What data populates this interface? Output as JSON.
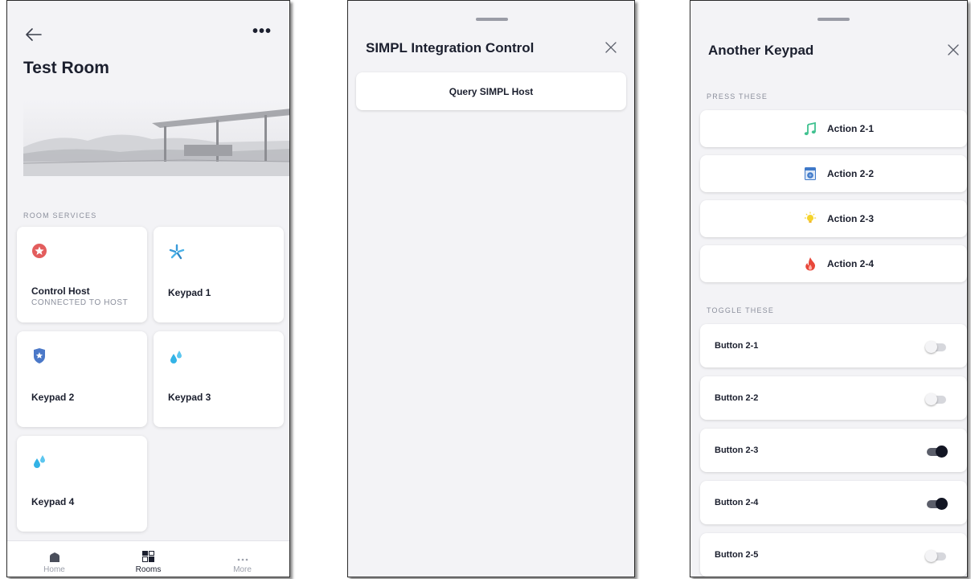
{
  "room": {
    "title": "Test Room",
    "section_label": "ROOM SERVICES",
    "tiles": [
      {
        "name": "Control Host",
        "subtitle": "CONNECTED TO HOST",
        "icon": "star-badge-icon",
        "color": "#e35d5d"
      },
      {
        "name": "Keypad 1",
        "subtitle": "",
        "icon": "pinwheel-icon",
        "color": "#3a9bd9"
      },
      {
        "name": "Keypad 2",
        "subtitle": "",
        "icon": "shield-star-icon",
        "color": "#4b78c8"
      },
      {
        "name": "Keypad 3",
        "subtitle": "",
        "icon": "water-drops-icon",
        "color": "#33b3e6"
      },
      {
        "name": "Keypad 4",
        "subtitle": "",
        "icon": "water-drops-icon",
        "color": "#33b3e6"
      }
    ],
    "nav": [
      {
        "label": "Home",
        "icon": "home-icon"
      },
      {
        "label": "Rooms",
        "icon": "rooms-grid-icon"
      },
      {
        "label": "More",
        "icon": "more-dots-icon"
      }
    ],
    "more_glyph": "•••"
  },
  "simpl": {
    "title": "SIMPL Integration Control",
    "query_label": "Query SIMPL Host"
  },
  "keypad": {
    "title": "Another Keypad",
    "press_label": "PRESS THESE",
    "toggle_label": "TOGGLE THESE",
    "actions": [
      {
        "label": "Action 2-1",
        "icon": "music-note-icon",
        "color": "#3fc18f"
      },
      {
        "label": "Action 2-2",
        "icon": "washer-icon",
        "color": "#3f79c9"
      },
      {
        "label": "Action 2-3",
        "icon": "lightbulb-icon",
        "color": "#f5d32a"
      },
      {
        "label": "Action 2-4",
        "icon": "flame-icon",
        "color": "#e8473a"
      }
    ],
    "toggles": [
      {
        "label": "Button 2-1",
        "on": false
      },
      {
        "label": "Button 2-2",
        "on": false
      },
      {
        "label": "Button 2-3",
        "on": true
      },
      {
        "label": "Button 2-4",
        "on": true
      },
      {
        "label": "Button 2-5",
        "on": false
      }
    ]
  }
}
